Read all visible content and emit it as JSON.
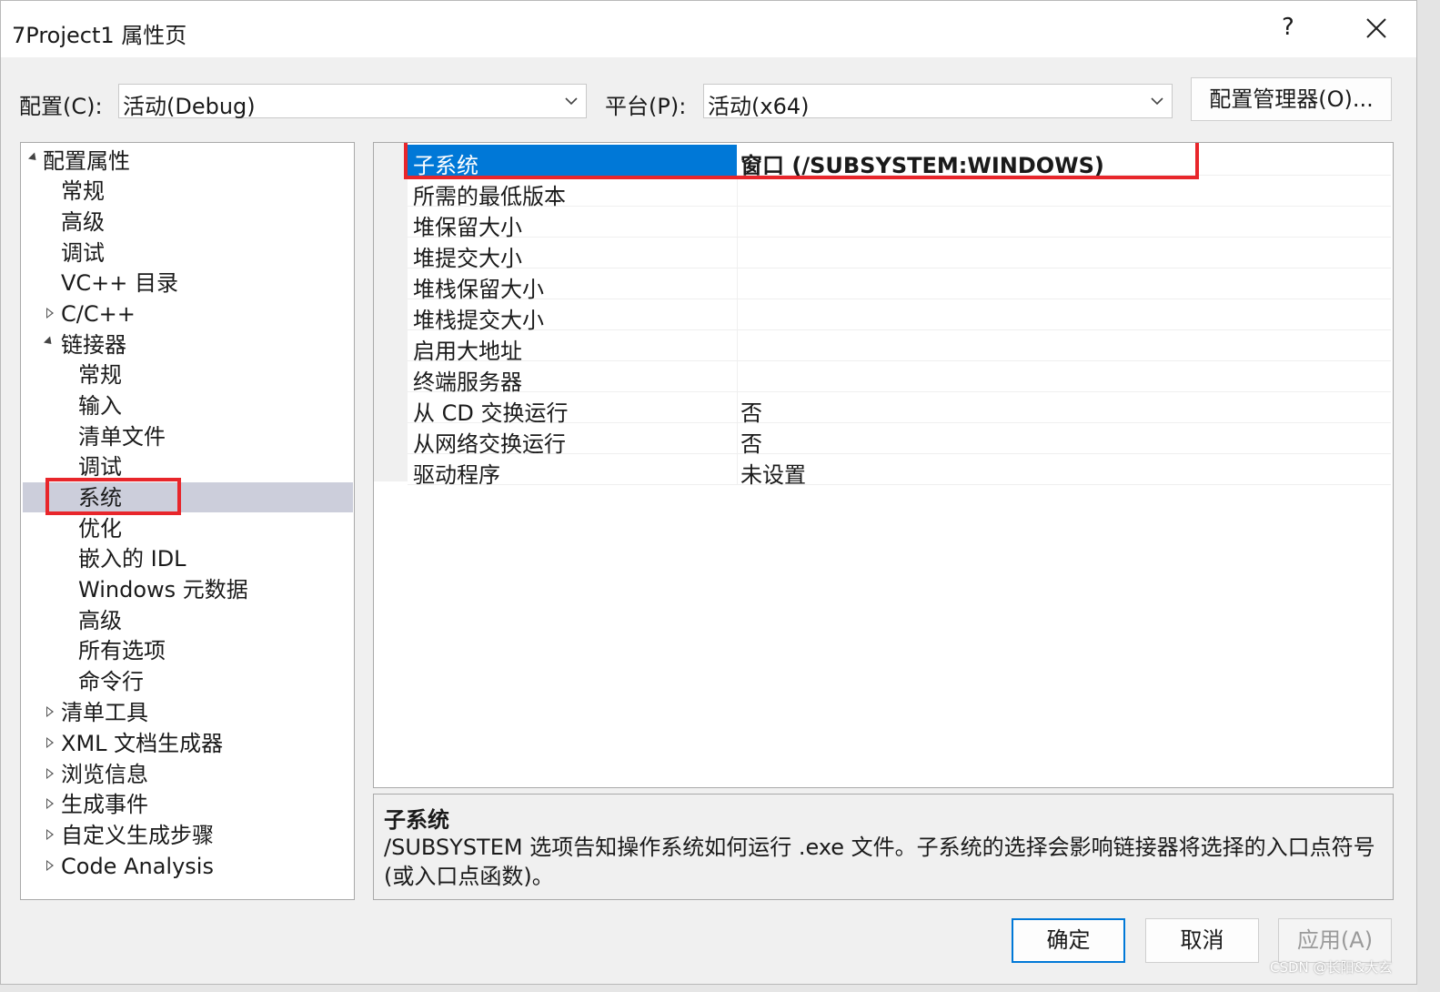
{
  "window": {
    "title": "7Project1 属性页",
    "help": "?"
  },
  "config_bar": {
    "config_label": "配置(C):",
    "config_value": "活动(Debug)",
    "platform_label": "平台(P):",
    "platform_value": "活动(x64)",
    "config_manager": "配置管理器(O)..."
  },
  "tree": {
    "items": [
      {
        "label": "配置属性",
        "expander": "expanded"
      },
      {
        "label": "常规"
      },
      {
        "label": "高级"
      },
      {
        "label": "调试"
      },
      {
        "label": "VC++ 目录"
      },
      {
        "label": "C/C++",
        "expander": "collapsed"
      },
      {
        "label": "链接器",
        "expander": "expanded"
      },
      {
        "label": "常规"
      },
      {
        "label": "输入"
      },
      {
        "label": "清单文件"
      },
      {
        "label": "调试"
      },
      {
        "label": "系统",
        "selected": true
      },
      {
        "label": "优化"
      },
      {
        "label": "嵌入的 IDL"
      },
      {
        "label": "Windows 元数据"
      },
      {
        "label": "高级"
      },
      {
        "label": "所有选项"
      },
      {
        "label": "命令行"
      },
      {
        "label": "清单工具",
        "expander": "collapsed"
      },
      {
        "label": "XML 文档生成器",
        "expander": "collapsed"
      },
      {
        "label": "浏览信息",
        "expander": "collapsed"
      },
      {
        "label": "生成事件",
        "expander": "collapsed"
      },
      {
        "label": "自定义生成步骤",
        "expander": "collapsed"
      },
      {
        "label": "Code Analysis",
        "expander": "collapsed"
      }
    ]
  },
  "properties": [
    {
      "name": "子系统",
      "value": "窗口 (/SUBSYSTEM:WINDOWS)",
      "selected": true
    },
    {
      "name": "所需的最低版本",
      "value": ""
    },
    {
      "name": "堆保留大小",
      "value": ""
    },
    {
      "name": "堆提交大小",
      "value": ""
    },
    {
      "name": "堆栈保留大小",
      "value": ""
    },
    {
      "name": "堆栈提交大小",
      "value": ""
    },
    {
      "name": "启用大地址",
      "value": ""
    },
    {
      "name": "终端服务器",
      "value": ""
    },
    {
      "name": "从 CD 交换运行",
      "value": "否"
    },
    {
      "name": "从网络交换运行",
      "value": "否"
    },
    {
      "name": "驱动程序",
      "value": "未设置"
    }
  ],
  "description": {
    "title": "子系统",
    "text": "/SUBSYSTEM 选项告知操作系统如何运行 .exe 文件。子系统的选择会影响链接器将选择的入口点符号(或入口点函数)。"
  },
  "buttons": {
    "ok": "确定",
    "cancel": "取消",
    "apply": "应用(A)"
  },
  "watermark": "CSDN @长阳&大玄",
  "colors": {
    "selection": "#0078d7",
    "highlight_box": "#e8262b",
    "tree_selection": "#cccedb"
  }
}
